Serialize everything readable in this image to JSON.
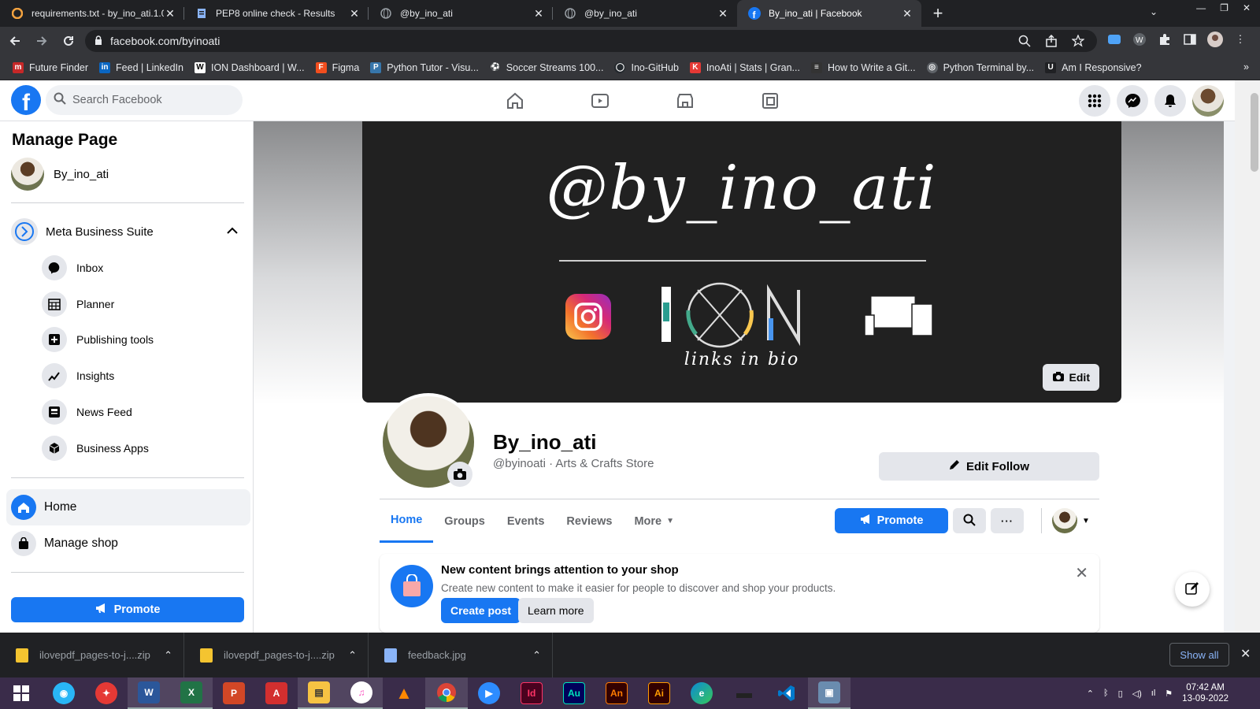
{
  "browser": {
    "tabs": [
      {
        "title": "requirements.txt - by_ino_ati.1.0",
        "icon": "g-icon",
        "color": "#f4a340"
      },
      {
        "title": "PEP8 online check - Results",
        "icon": "doc-icon",
        "color": "#8ab4f8"
      },
      {
        "title": "@by_ino_ati",
        "icon": "globe-icon",
        "color": "#9aa0a6"
      },
      {
        "title": "@by_ino_ati",
        "icon": "globe-icon",
        "color": "#9aa0a6"
      },
      {
        "title": "By_ino_ati | Facebook",
        "icon": "facebook-icon",
        "color": "#1877f2",
        "active": true
      }
    ],
    "url": "facebook.com/byinoati",
    "bookmarks": [
      {
        "label": "Future Finder",
        "color": "#c62828",
        "glyph": "m"
      },
      {
        "label": "Feed | LinkedIn",
        "color": "#0a66c2",
        "glyph": "in"
      },
      {
        "label": "ION Dashboard | W...",
        "color": "#ffffff",
        "glyph": "W"
      },
      {
        "label": "Figma",
        "color": "#f24e1e",
        "glyph": "F"
      },
      {
        "label": "Python Tutor - Visu...",
        "color": "#3776ab",
        "glyph": "P"
      },
      {
        "label": "Soccer Streams 100...",
        "color": "#ffffff",
        "glyph": "⚽"
      },
      {
        "label": "Ino-GitHub",
        "color": "#24292e",
        "glyph": "◯"
      },
      {
        "label": "InoAti | Stats | Gran...",
        "color": "#e53935",
        "glyph": "K"
      },
      {
        "label": "How to Write a Git...",
        "color": "#333333",
        "glyph": "≡"
      },
      {
        "label": "Python Terminal by...",
        "color": "#5f6368",
        "glyph": "◎"
      },
      {
        "label": "Am I Responsive?",
        "color": "#202124",
        "glyph": "U"
      }
    ]
  },
  "facebook": {
    "search_placeholder": "Search Facebook",
    "sidebar": {
      "title": "Manage Page",
      "page_name": "By_ino_ati",
      "suite_label": "Meta Business Suite",
      "suite_items": [
        "Inbox",
        "Planner",
        "Publishing tools",
        "Insights",
        "News Feed",
        "Business Apps"
      ],
      "nav": [
        "Home",
        "Manage shop"
      ],
      "promote_label": "Promote"
    },
    "cover": {
      "title": "@by_ino_ati",
      "subtitle": "links in bio",
      "edit_label": "Edit"
    },
    "profile": {
      "name": "By_ino_ati",
      "handle": "@byinoati · Arts & Crafts Store",
      "edit_follow_label": "Edit Follow"
    },
    "tabs": [
      "Home",
      "Groups",
      "Events",
      "Reviews",
      "More"
    ],
    "promote_label": "Promote",
    "notice": {
      "title": "New content brings attention to your shop",
      "desc": "Create new content to make it easier for people to discover and shop your products.",
      "create_label": "Create post",
      "learn_label": "Learn more"
    },
    "colors": {
      "accent": "#1877f2"
    }
  },
  "downloads": {
    "items": [
      "ilovepdf_pages-to-j....zip",
      "ilovepdf_pages-to-j....zip",
      "feedback.jpg"
    ],
    "show_all_label": "Show all"
  },
  "taskbar": {
    "time": "07:42 AM",
    "date": "13-09-2022",
    "apps": [
      {
        "name": "windows-start",
        "color": "#ffffff",
        "glyph": "⊞"
      },
      {
        "name": "app-blue",
        "color": "#29b6f6",
        "glyph": "◉"
      },
      {
        "name": "app-red",
        "color": "#e53935",
        "glyph": "✦"
      },
      {
        "name": "word",
        "color": "#2b579a",
        "glyph": "W"
      },
      {
        "name": "excel",
        "color": "#217346",
        "glyph": "X"
      },
      {
        "name": "powerpoint",
        "color": "#d24726",
        "glyph": "P"
      },
      {
        "name": "acrobat",
        "color": "#d32f2f",
        "glyph": "A"
      },
      {
        "name": "file-explorer",
        "color": "#f6c343",
        "glyph": "▤"
      },
      {
        "name": "itunes",
        "color": "#fa57c1",
        "glyph": "♫"
      },
      {
        "name": "vlc",
        "color": "#ff8800",
        "glyph": "▲"
      },
      {
        "name": "chrome",
        "color": "#4285f4",
        "glyph": "●"
      },
      {
        "name": "zoom",
        "color": "#2d8cff",
        "glyph": "▶"
      },
      {
        "name": "indesign",
        "color": "#49021f",
        "glyph": "Id"
      },
      {
        "name": "audition",
        "color": "#00005b",
        "glyph": "Au"
      },
      {
        "name": "animate",
        "color": "#330000",
        "glyph": "An"
      },
      {
        "name": "illustrator",
        "color": "#330000",
        "glyph": "Ai"
      },
      {
        "name": "edge",
        "color": "#0c8ad6",
        "glyph": "e"
      },
      {
        "name": "terminal",
        "color": "#333333",
        "glyph": "▬"
      },
      {
        "name": "vscode",
        "color": "#007acc",
        "glyph": "◁"
      },
      {
        "name": "photos",
        "color": "#6a8caf",
        "glyph": "▣"
      }
    ]
  }
}
